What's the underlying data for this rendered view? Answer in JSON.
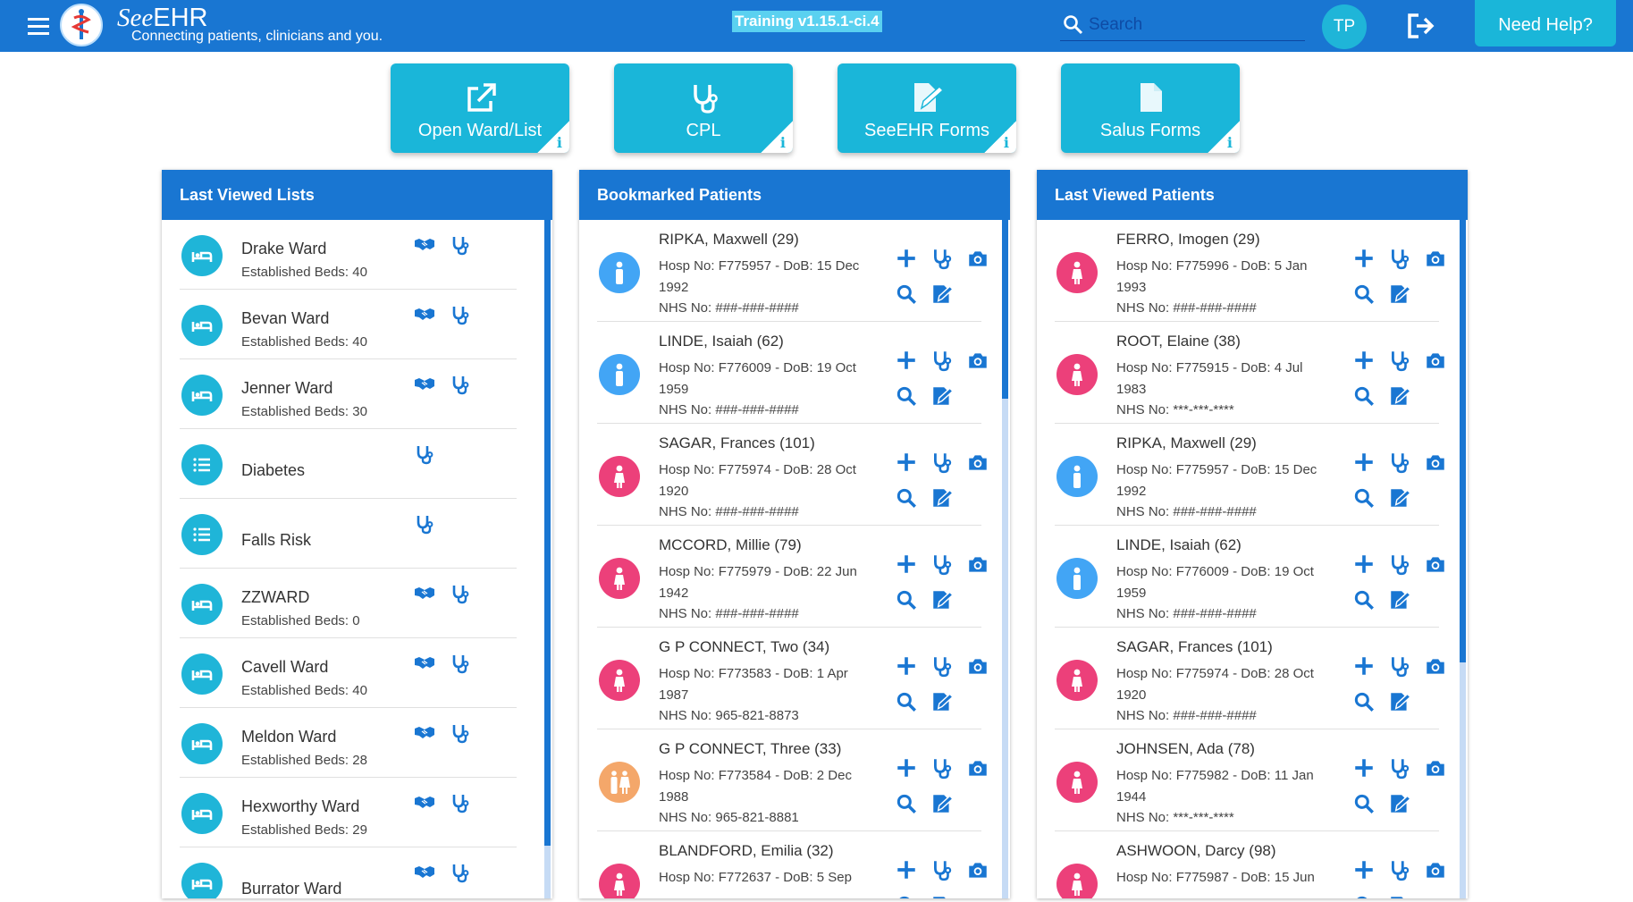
{
  "app": {
    "logo_see": "See",
    "logo_ehr": "EHR",
    "tagline": "Connecting patients, clinicians and you.",
    "environment": "Training v1.15.1-ci.4",
    "search_placeholder": "Search",
    "user_initials": "TP",
    "help_label": "Need Help?"
  },
  "tiles": [
    {
      "label": "Open Ward/List",
      "icon": "open-external-icon",
      "info": "i"
    },
    {
      "label": "CPL",
      "icon": "stethoscope-icon",
      "info": "i"
    },
    {
      "label": "SeeEHR Forms",
      "icon": "edit-document-icon",
      "info": "i"
    },
    {
      "label": "Salus Forms",
      "icon": "document-icon",
      "info": "i"
    }
  ],
  "last_viewed_lists": {
    "title": "Last Viewed Lists",
    "items": [
      {
        "name": "Drake Ward",
        "sub": "Established Beds: 40",
        "type": "ward"
      },
      {
        "name": "Bevan Ward",
        "sub": "Established Beds: 40",
        "type": "ward"
      },
      {
        "name": "Jenner Ward",
        "sub": "Established Beds: 30",
        "type": "ward"
      },
      {
        "name": "Diabetes",
        "sub": "",
        "type": "list"
      },
      {
        "name": "Falls Risk",
        "sub": "",
        "type": "list"
      },
      {
        "name": "ZZWARD",
        "sub": "Established Beds: 0",
        "type": "ward"
      },
      {
        "name": "Cavell Ward",
        "sub": "Established Beds: 40",
        "type": "ward"
      },
      {
        "name": "Meldon Ward",
        "sub": "Established Beds: 28",
        "type": "ward"
      },
      {
        "name": "Hexworthy Ward",
        "sub": "Established Beds: 29",
        "type": "ward"
      },
      {
        "name": "Burrator Ward",
        "sub": "",
        "type": "ward"
      }
    ]
  },
  "bookmarked_patients": {
    "title": "Bookmarked Patients",
    "items": [
      {
        "name": "RIPKA, Maxwell (29)",
        "hosp": "Hosp No: F775957 - DoB: 15 Dec 1992",
        "nhs": "NHS No: ###-###-####",
        "gender": "male"
      },
      {
        "name": "LINDE, Isaiah (62)",
        "hosp": "Hosp No: F776009 - DoB: 19 Oct 1959",
        "nhs": "NHS No: ###-###-####",
        "gender": "male"
      },
      {
        "name": "SAGAR, Frances (101)",
        "hosp": "Hosp No: F775974 - DoB: 28 Oct 1920",
        "nhs": "NHS No: ###-###-####",
        "gender": "female"
      },
      {
        "name": "MCCORD, Millie (79)",
        "hosp": "Hosp No: F775979 - DoB: 22 Jun 1942",
        "nhs": "NHS No: ###-###-####",
        "gender": "female"
      },
      {
        "name": "G P CONNECT, Two (34)",
        "hosp": "Hosp No: F773583 - DoB: 1 Apr 1987",
        "nhs": "NHS No: 965-821-8873",
        "gender": "female"
      },
      {
        "name": "G P CONNECT, Three (33)",
        "hosp": "Hosp No: F773584 - DoB: 2 Dec 1988",
        "nhs": "NHS No: 965-821-8881",
        "gender": "unknown"
      },
      {
        "name": "BLANDFORD, Emilia (32)",
        "hosp": "Hosp No: F772637 - DoB: 5 Sep",
        "nhs": "",
        "gender": "female"
      }
    ]
  },
  "last_viewed_patients": {
    "title": "Last Viewed Patients",
    "items": [
      {
        "name": "FERRO, Imogen (29)",
        "hosp": "Hosp No: F775996 - DoB: 5 Jan 1993",
        "nhs": "NHS No: ###-###-####",
        "gender": "female"
      },
      {
        "name": "ROOT, Elaine (38)",
        "hosp": "Hosp No: F775915 - DoB: 4 Jul 1983",
        "nhs": "NHS No: ***-***-****",
        "gender": "female"
      },
      {
        "name": "RIPKA, Maxwell (29)",
        "hosp": "Hosp No: F775957 - DoB: 15 Dec 1992",
        "nhs": "NHS No: ###-###-####",
        "gender": "male"
      },
      {
        "name": "LINDE, Isaiah (62)",
        "hosp": "Hosp No: F776009 - DoB: 19 Oct 1959",
        "nhs": "NHS No: ###-###-####",
        "gender": "male"
      },
      {
        "name": "SAGAR, Frances (101)",
        "hosp": "Hosp No: F775974 - DoB: 28 Oct 1920",
        "nhs": "NHS No: ###-###-####",
        "gender": "female"
      },
      {
        "name": "JOHNSEN, Ada (78)",
        "hosp": "Hosp No: F775982 - DoB: 11 Jan 1944",
        "nhs": "NHS No: ***-***-****",
        "gender": "female"
      },
      {
        "name": "ASHWOON, Darcy (98)",
        "hosp": "Hosp No: F775987 - DoB: 15 Jun",
        "nhs": "",
        "gender": "female"
      }
    ]
  },
  "colors": {
    "primary": "#1976d2",
    "accent": "#1ab6d9",
    "male": "#42a5f5",
    "female": "#ec407a",
    "unknown": "#f4a76a"
  }
}
